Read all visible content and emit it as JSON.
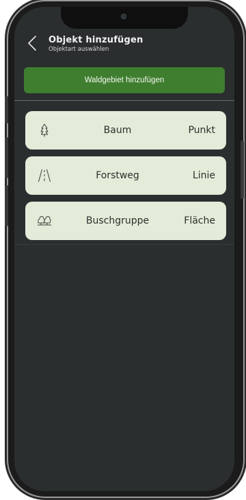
{
  "header": {
    "title": "Objekt hinzufügen",
    "subtitle": "Objektart auswählen",
    "back_icon": "chevron-left-icon"
  },
  "add_button": {
    "label": "Waldgebiet hinzufügen"
  },
  "object_types": [
    {
      "name": "Baum",
      "type": "Punkt",
      "icon": "tree-icon"
    },
    {
      "name": "Forstweg",
      "type": "Linie",
      "icon": "road-icon"
    },
    {
      "name": "Buschgruppe",
      "type": "Fläche",
      "icon": "bush-group-icon"
    }
  ],
  "colors": {
    "screen_background": "#2b2e2f",
    "accent_green": "#3f7e2f",
    "item_background": "#e3ecd9"
  }
}
